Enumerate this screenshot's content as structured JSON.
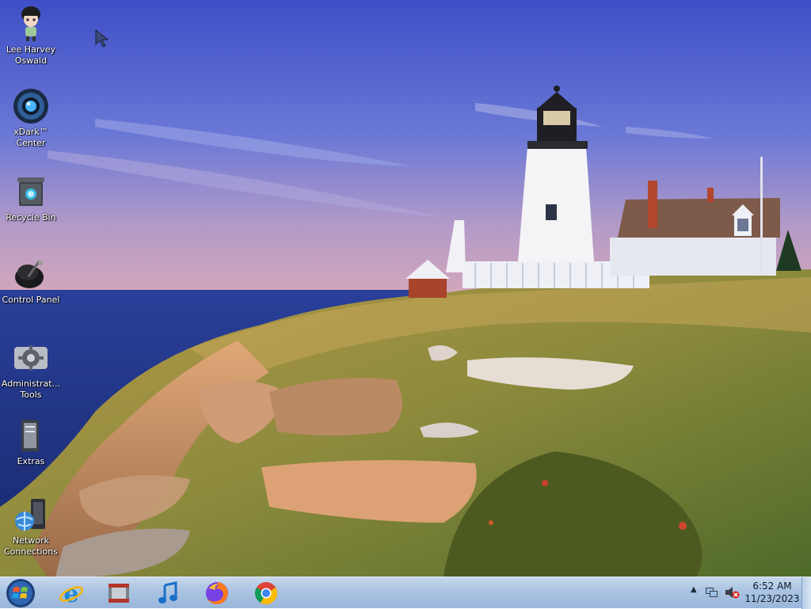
{
  "desktop": {
    "icons": [
      {
        "name": "lee-harvey-oswald",
        "label": "Lee Harvey\nOswald",
        "icon": "person-avatar-icon"
      },
      {
        "name": "xdark-center",
        "label": "xDark™\nCenter",
        "icon": "xdark-center-icon"
      },
      {
        "name": "recycle-bin",
        "label": "Recycle Bin",
        "icon": "recycle-bin-icon"
      },
      {
        "name": "control-panel",
        "label": "Control Panel",
        "icon": "control-panel-icon"
      },
      {
        "name": "administrative-tools",
        "label": "Administrat...\nTools",
        "icon": "admin-tools-icon"
      },
      {
        "name": "extras",
        "label": "Extras",
        "icon": "extras-icon"
      },
      {
        "name": "network-connections",
        "label": "Network\nConnections",
        "icon": "network-connections-icon"
      }
    ]
  },
  "taskbar": {
    "pinned": [
      {
        "name": "internet-explorer",
        "icon": "internet-explorer-icon"
      },
      {
        "name": "media-player",
        "icon": "media-film-icon"
      },
      {
        "name": "music",
        "icon": "music-note-icon"
      },
      {
        "name": "firefox",
        "icon": "firefox-icon"
      },
      {
        "name": "chrome",
        "icon": "chrome-icon"
      }
    ],
    "tray": {
      "time": "6:52 AM",
      "date": "11/23/2023",
      "chevron": "▲"
    }
  },
  "colors": {
    "sky_top": "#3f4fc4",
    "sea": "#1f3a8a",
    "taskbar": "#a9c3e2"
  }
}
